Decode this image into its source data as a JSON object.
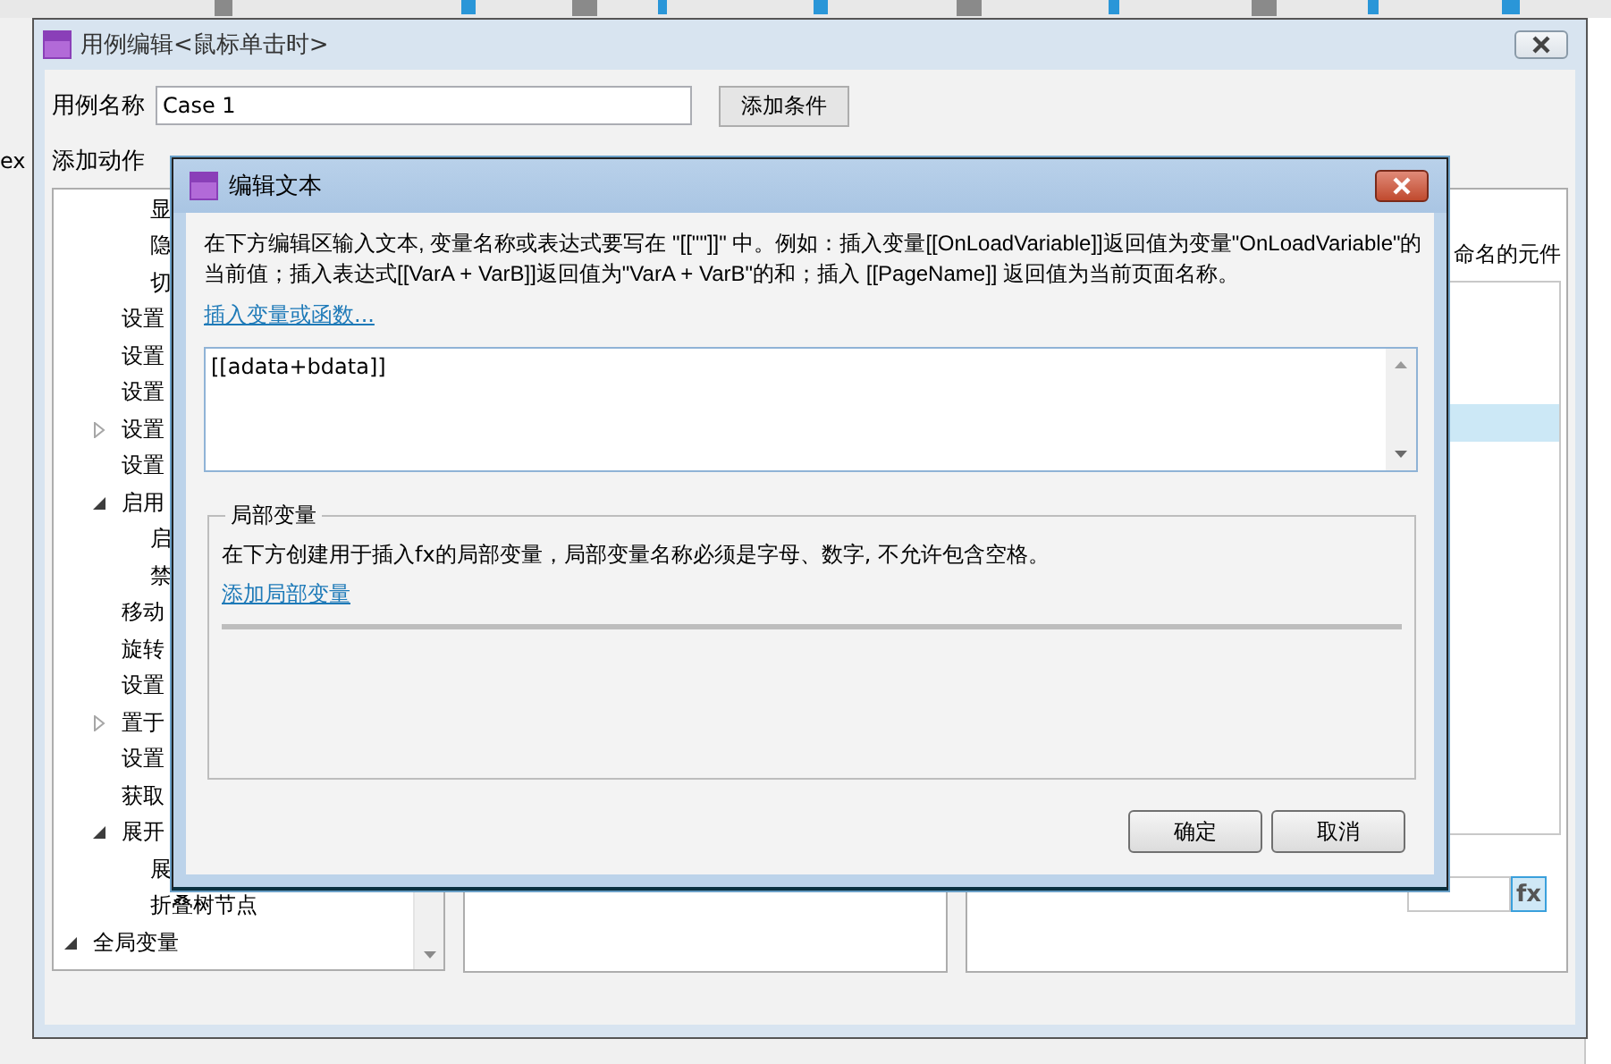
{
  "background_app": {
    "left_text": "ex"
  },
  "dialog": {
    "title": "用例编辑<鼠标单击时>",
    "case_name_label": "用例名称",
    "case_name_value": "Case 1",
    "add_condition_button": "添加条件",
    "columns": [
      "添加动作"
    ],
    "action_tree": [
      {
        "children": [
          {
            "children": [
              {
                "label": "显"
              },
              {
                "label": "隐"
              },
              {
                "label": "切"
              }
            ]
          },
          {
            "label": "设置"
          },
          {
            "label": "设置"
          },
          {
            "label": "设置"
          },
          {
            "label": "设置",
            "expanded": false
          },
          {
            "label": "设置"
          },
          {
            "label": "启用",
            "expanded": true,
            "children": [
              {
                "label": "启"
              },
              {
                "label": "禁"
              }
            ]
          },
          {
            "label": "移动"
          },
          {
            "label": "旋转"
          },
          {
            "label": "设置"
          },
          {
            "label": "置于",
            "expanded": false
          },
          {
            "label": "设置"
          },
          {
            "label": "获取"
          },
          {
            "label": "展开",
            "expanded": true,
            "children": [
              {
                "label": "展"
              },
              {
                "label": "折叠树节点"
              }
            ]
          }
        ]
      },
      {
        "label": "全局变量",
        "expanded": true
      }
    ],
    "config_hint": "命名的元件",
    "config_rows": [
      {
        "selected": false
      },
      {
        "selected": false
      },
      {
        "selected": false
      },
      {
        "selected": true
      }
    ],
    "fx_button": "fx"
  },
  "edit_dialog": {
    "title": "编辑文本",
    "instructions": "在下方编辑区输入文本, 变量名称或表达式要写在 \"[[\"\"]]\" 中。例如：插入变量[[OnLoadVariable]]返回值为变量\"OnLoadVariable\"的当前值；插入表达式[[VarA + VarB]]返回值为\"VarA + VarB\"的和；插入 [[PageName]] 返回值为当前页面名称。",
    "insert_link": "插入变量或函数...",
    "expression": "[[adata+bdata]]",
    "local_variables": {
      "legend": "局部变量",
      "hint": "在下方创建用于插入fx的局部变量，局部变量名称必须是字母、数字, 不允许包含空格。",
      "add_link": "添加局部变量"
    },
    "buttons": [
      "确定",
      "取消"
    ]
  }
}
